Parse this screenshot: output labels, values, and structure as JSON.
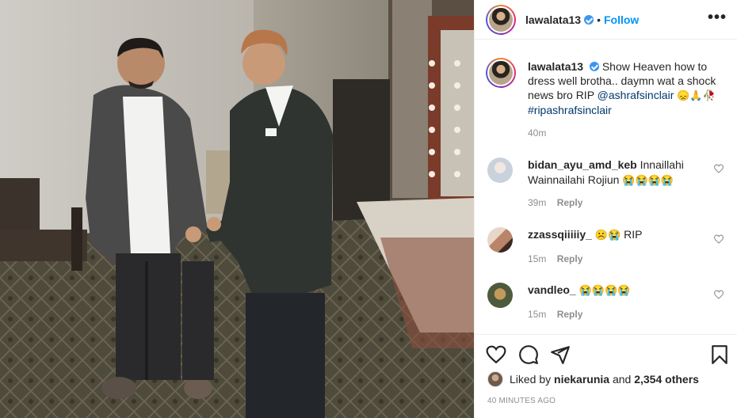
{
  "post": {
    "author": "lawalata13",
    "follow_label": "Follow",
    "more_label": "•••",
    "caption": {
      "username": "lawalata13",
      "text": "Show Heaven how to dress well brotha.. daymn wat a shock news bro RIP",
      "mention": "@ashrafsinclair",
      "emojis": "😞🙏🥀",
      "hashtag": "#ripashrafsinclair",
      "time": "40m"
    },
    "comments": [
      {
        "username": "bidan_ayu_amd_keb",
        "text": "Innaillahi Wainnailahi Rojiun",
        "emojis": "😭😭😭😭",
        "time": "39m",
        "reply_label": "Reply",
        "avatar_color": "#c9d2dc"
      },
      {
        "username": "zzassqiiiiiy_",
        "text": "RIP",
        "emojis_before": "☹️😭",
        "time": "15m",
        "reply_label": "Reply",
        "avatar_color": "#b9846a"
      },
      {
        "username": "vandleo_",
        "text": "",
        "emojis": "😭😭😭😭",
        "time": "15m",
        "reply_label": "Reply",
        "avatar_color": "#4d5a3c"
      }
    ],
    "likes": {
      "prefix": "Liked by",
      "liker": "niekarunia",
      "connector": "and",
      "others": "2,354 others"
    },
    "posted_time": "40 MINUTES AGO"
  },
  "icons": {
    "verified": "verified-badge-icon",
    "like": "heart-icon",
    "comment": "comment-icon",
    "share": "paper-plane-icon",
    "save": "bookmark-icon"
  },
  "colors": {
    "accent": "#0095f6",
    "verified": "#3897f0",
    "mention": "#00376b",
    "muted": "#8e8e8e",
    "text": "#262626",
    "border": "#efefef"
  }
}
